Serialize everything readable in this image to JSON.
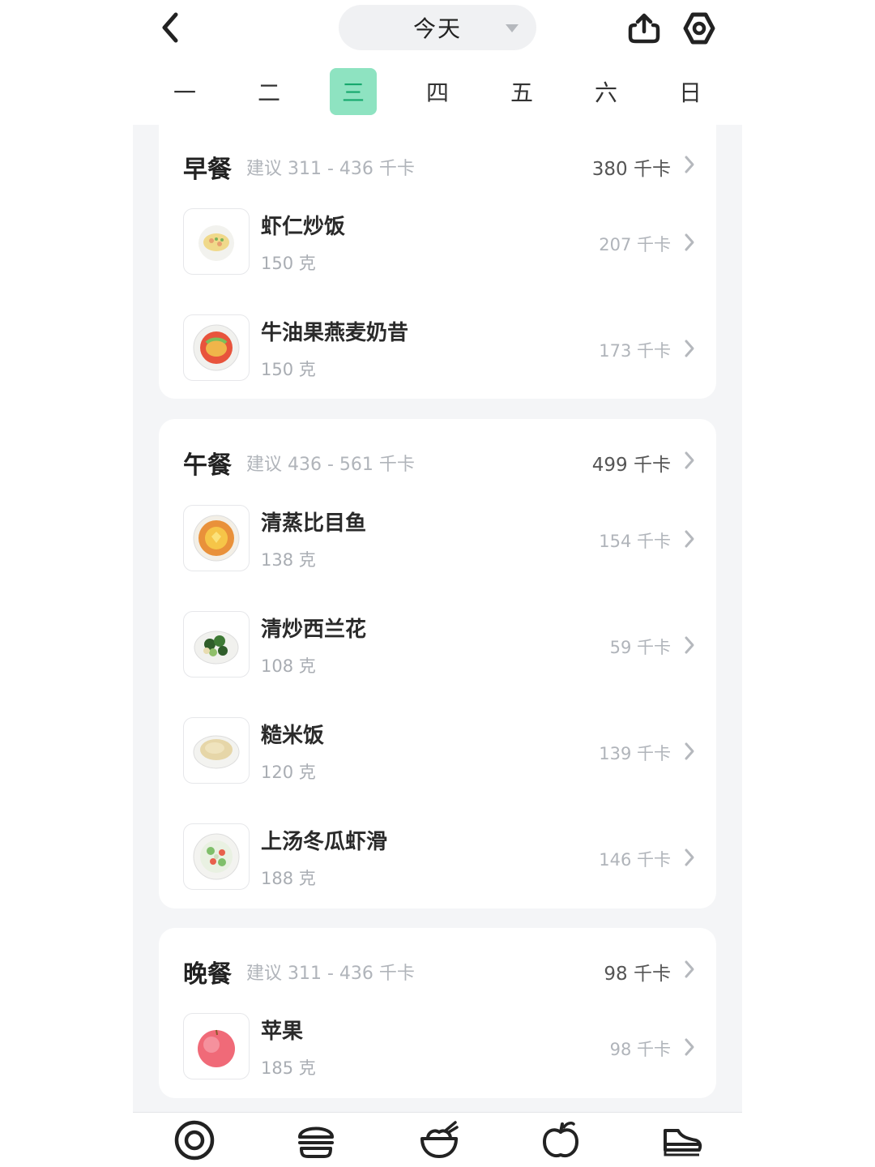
{
  "header": {
    "date_label": "今天",
    "back_icon": "chevron-left-icon",
    "share_icon": "share-upload-icon",
    "settings_icon": "hexagon-settings-icon"
  },
  "weekdays": [
    {
      "label": "一",
      "active": false
    },
    {
      "label": "二",
      "active": false
    },
    {
      "label": "三",
      "active": true
    },
    {
      "label": "四",
      "active": false
    },
    {
      "label": "五",
      "active": false
    },
    {
      "label": "六",
      "active": false
    },
    {
      "label": "日",
      "active": false
    }
  ],
  "colors": {
    "accent": "#16a86d",
    "accent_bg": "#8ee3c1",
    "page_bg": "#f4f5f7"
  },
  "meals": [
    {
      "title": "早餐",
      "suggest": "建议 311 - 436 千卡",
      "total": "380 千卡",
      "items": [
        {
          "name": "虾仁炒饭",
          "weight": "150 克",
          "kcal": "207 千卡"
        },
        {
          "name": "牛油果燕麦奶昔",
          "weight": "150 克",
          "kcal": "173 千卡"
        }
      ]
    },
    {
      "title": "午餐",
      "suggest": "建议 436 - 561 千卡",
      "total": "499 千卡",
      "items": [
        {
          "name": "清蒸比目鱼",
          "weight": "138 克",
          "kcal": "154 千卡"
        },
        {
          "name": "清炒西兰花",
          "weight": "108 克",
          "kcal": "59 千卡"
        },
        {
          "name": "糙米饭",
          "weight": "120 克",
          "kcal": "139 千卡"
        },
        {
          "name": "上汤冬瓜虾滑",
          "weight": "188 克",
          "kcal": "146 千卡"
        }
      ]
    },
    {
      "title": "晚餐",
      "suggest": "建议 311 - 436 千卡",
      "total": "98 千卡",
      "items": [
        {
          "name": "苹果",
          "weight": "185 克",
          "kcal": "98 千卡"
        }
      ]
    }
  ],
  "bottom_nav": [
    {
      "icon": "plate-icon"
    },
    {
      "icon": "burger-icon"
    },
    {
      "icon": "rice-bowl-icon"
    },
    {
      "icon": "apple-icon"
    },
    {
      "icon": "sneaker-icon"
    }
  ]
}
